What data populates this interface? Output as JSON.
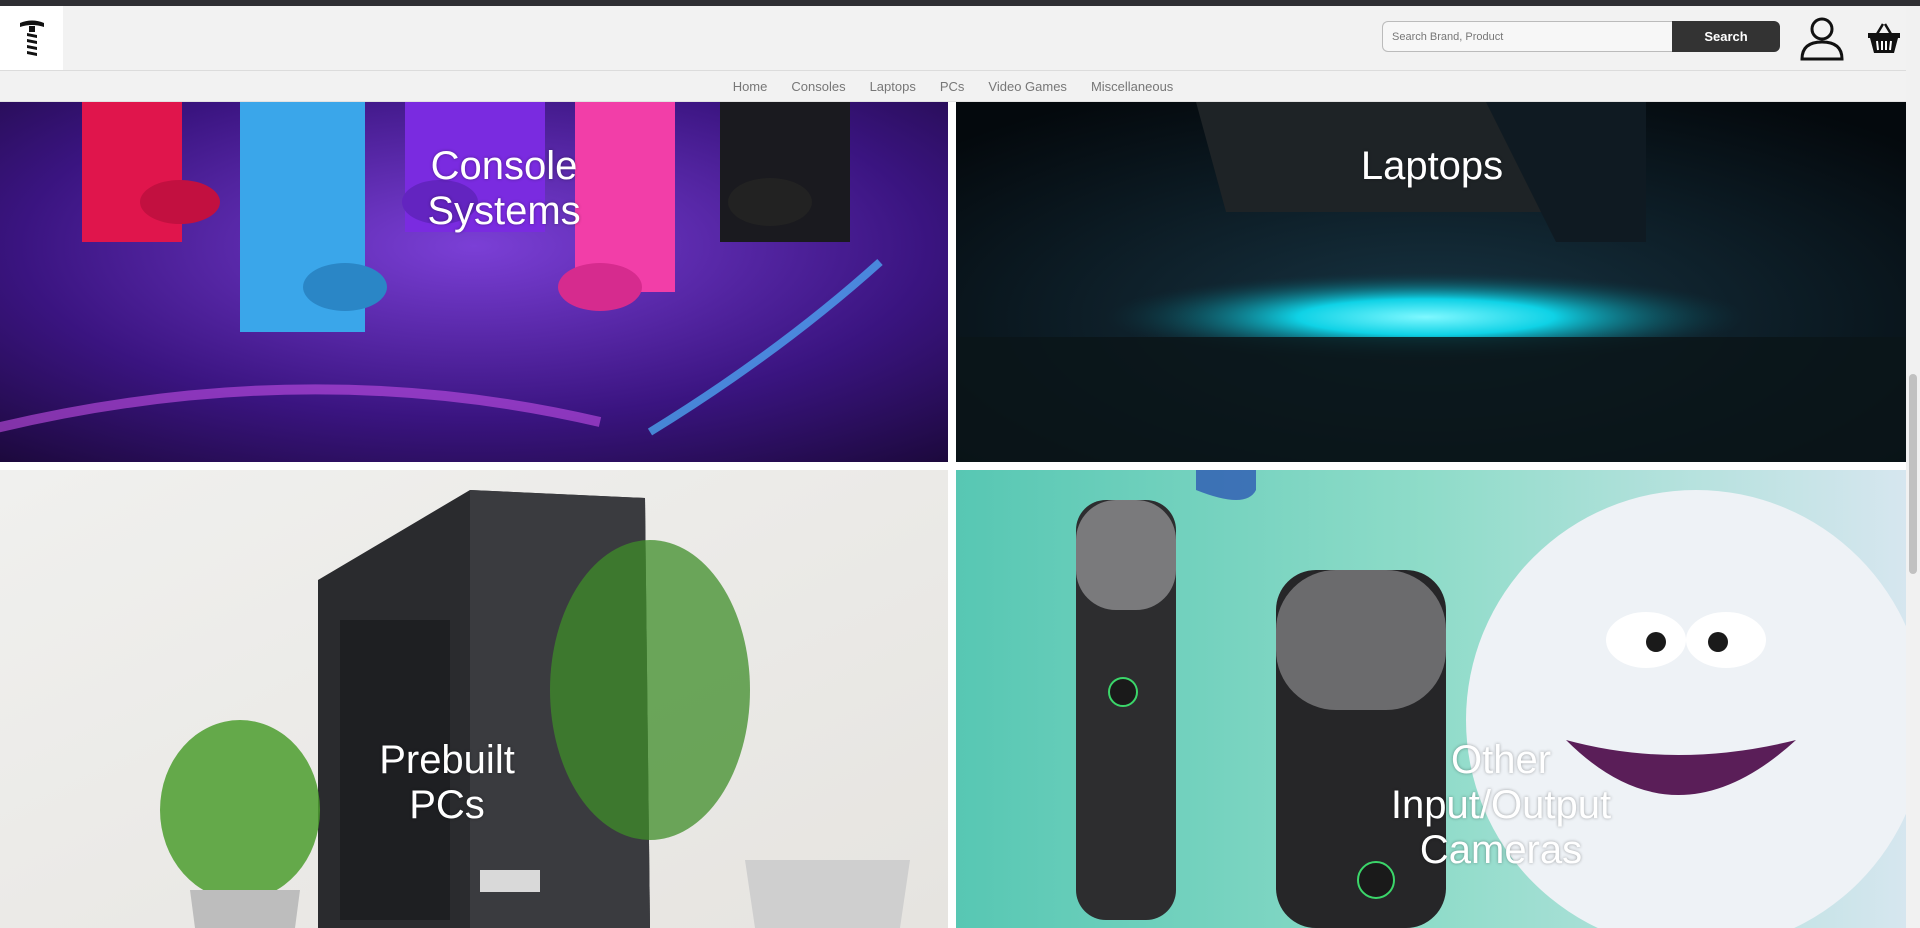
{
  "header": {
    "logo_alt": "store-logo",
    "search_placeholder": "Search Brand, Product",
    "search_label": "Search"
  },
  "nav": {
    "items": [
      "Home",
      "Consoles",
      "Laptops",
      "PCs",
      "Video Games",
      "Miscellaneous"
    ]
  },
  "tiles": [
    {
      "label": "Console\nSystems"
    },
    {
      "label": "Laptops"
    },
    {
      "label": "Prebuilt\nPCs"
    },
    {
      "label": "Other\nInput/Output\nCameras"
    }
  ],
  "colors": {
    "header_bg": "#f2f2f2",
    "search_button": "#333333",
    "nav_text": "#777777"
  }
}
